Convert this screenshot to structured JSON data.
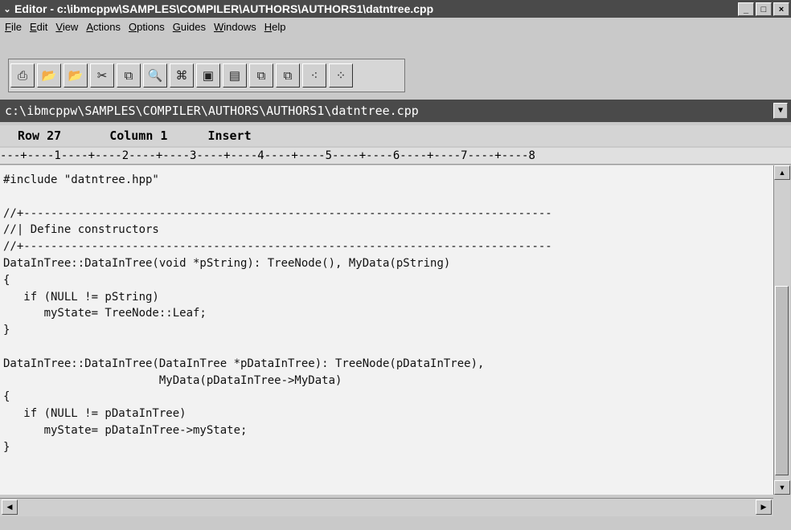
{
  "window": {
    "title": "Editor - c:\\ibmcppw\\SAMPLES\\COMPILER\\AUTHORS\\AUTHORS1\\datntree.cpp",
    "sys_menu_icon": "chevron-down-icon",
    "buttons": {
      "minimize": "_",
      "maximize": "□",
      "close": "×"
    }
  },
  "menubar": {
    "items": [
      "File",
      "Edit",
      "View",
      "Actions",
      "Options",
      "Guides",
      "Windows",
      "Help"
    ]
  },
  "toolbar": {
    "icons": [
      "new-file-icon",
      "open-folder-icon",
      "open-folder-icon",
      "cut-icon",
      "copy-icon",
      "search-icon",
      "find-icon",
      "window-icon",
      "list-icon",
      "window-copy-icon",
      "window-group-icon",
      "cascade-icon",
      "tile-icon"
    ],
    "glyphs": [
      "⎙",
      "📂",
      "📂",
      "✂",
      "⧉",
      "🔍",
      "⌘",
      "▣",
      "▤",
      "⧉",
      "⧉",
      "⁖",
      "⁘"
    ]
  },
  "pathbar": {
    "path": "c:\\ibmcppw\\SAMPLES\\COMPILER\\AUTHORS\\AUTHORS1\\datntree.cpp",
    "dropdown_icon": "chevron-down-icon"
  },
  "status": {
    "row": "Row 27",
    "column": "Column 1",
    "mode": "Insert"
  },
  "ruler": "---+----1----+----2----+----3----+----4----+----5----+----6----+----7----+----8",
  "code": "#include \"datntree.hpp\"\n\n//+------------------------------------------------------------------------------\n//| Define constructors\n//+------------------------------------------------------------------------------\nDataInTree::DataInTree(void *pString): TreeNode(), MyData(pString)\n{\n   if (NULL != pString)\n      myState= TreeNode::Leaf;\n}\n\nDataInTree::DataInTree(DataInTree *pDataInTree): TreeNode(pDataInTree),\n                       MyData(pDataInTree->MyData)\n{\n   if (NULL != pDataInTree)\n      myState= pDataInTree->myState;\n}",
  "scroll": {
    "up_icon": "▲",
    "down_icon": "▼",
    "left_icon": "◀",
    "right_icon": "▶"
  }
}
